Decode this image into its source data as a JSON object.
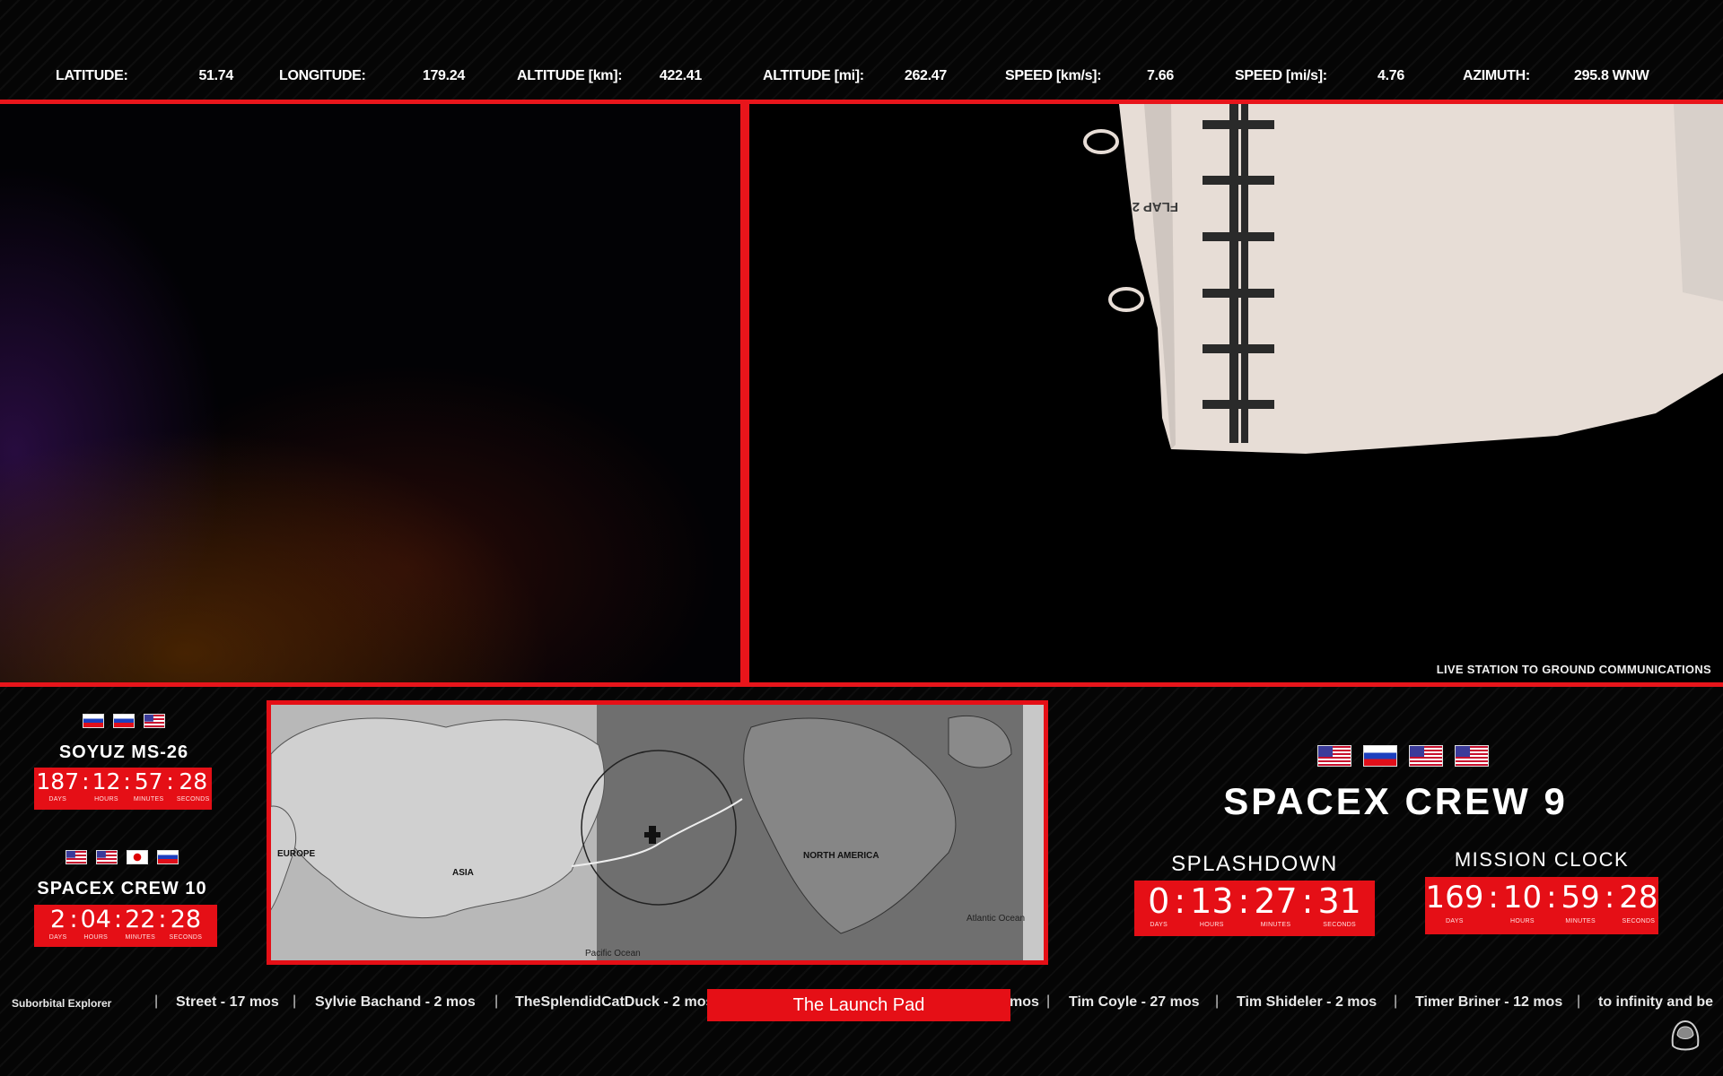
{
  "telemetry": {
    "latitude_label": "LATITUDE:",
    "latitude_value": "51.74",
    "longitude_label": "LONGITUDE:",
    "longitude_value": "179.24",
    "alt_km_label": "ALTITUDE [km]:",
    "alt_km_value": "422.41",
    "alt_mi_label": "ALTITUDE [mi]:",
    "alt_mi_value": "262.47",
    "speed_kms_label": "SPEED [km/s]:",
    "speed_kms_value": "7.66",
    "speed_mis_label": "SPEED [mi/s]:",
    "speed_mis_value": "4.76",
    "azimuth_label": "AZIMUTH:",
    "azimuth_value": "295.8 WNW"
  },
  "right_feed": {
    "caption": "LIVE STATION TO GROUND COMMUNICATIONS",
    "module_label": "FLAP 2"
  },
  "soyuz": {
    "flags": [
      "russia",
      "russia",
      "usa"
    ],
    "name": "SOYUZ MS-26",
    "days": "187",
    "hours": "12",
    "minutes": "57",
    "seconds": "28",
    "cap_days": "DAYS",
    "cap_hours": "HOURS",
    "cap_minutes": "MINUTES",
    "cap_seconds": "SECONDS"
  },
  "crew10": {
    "flags": [
      "usa",
      "usa",
      "japan",
      "russia"
    ],
    "name": "SPACEX CREW 10",
    "days": "2",
    "hours": "04",
    "minutes": "22",
    "seconds": "28",
    "cap_days": "DAYS",
    "cap_hours": "HOURS",
    "cap_minutes": "MINUTES",
    "cap_seconds": "SECONDS"
  },
  "map": {
    "labels": {
      "europe": "EUROPE",
      "asia": "ASIA",
      "north_america": "NORTH AMERICA",
      "pacific": "Pacific Ocean",
      "atlantic": "Atlantic Ocean"
    }
  },
  "crew9": {
    "flags": [
      "usa",
      "russia",
      "usa",
      "usa"
    ],
    "name": "SPACEX CREW 9",
    "splashdown_title": "SPLASHDOWN",
    "splashdown": {
      "days": "0",
      "hours": "13",
      "minutes": "27",
      "seconds": "31"
    },
    "mission_title": "MISSION CLOCK",
    "mission": {
      "days": "169",
      "hours": "10",
      "minutes": "59",
      "seconds": "28"
    },
    "cap_days": "DAYS",
    "cap_hours": "HOURS",
    "cap_minutes": "MINUTES",
    "cap_seconds": "SECONDS"
  },
  "ticker": {
    "items": [
      "Suborbital Explorer",
      "Street - 17 mos",
      "Sylvie Bachand - 2 mos",
      "TheSplendidCatDuck - 2 mos",
      "mos",
      "Tim Coyle - 27 mos",
      "Tim Shideler - 2 mos",
      "Timer Briner - 12 mos",
      "to infinity and be"
    ],
    "separator": "|",
    "brand": "The Launch Pad"
  },
  "colors": {
    "accent": "#e50f16",
    "background": "#000000"
  },
  "icons": [
    "helmet-icon",
    "iss-icon"
  ]
}
